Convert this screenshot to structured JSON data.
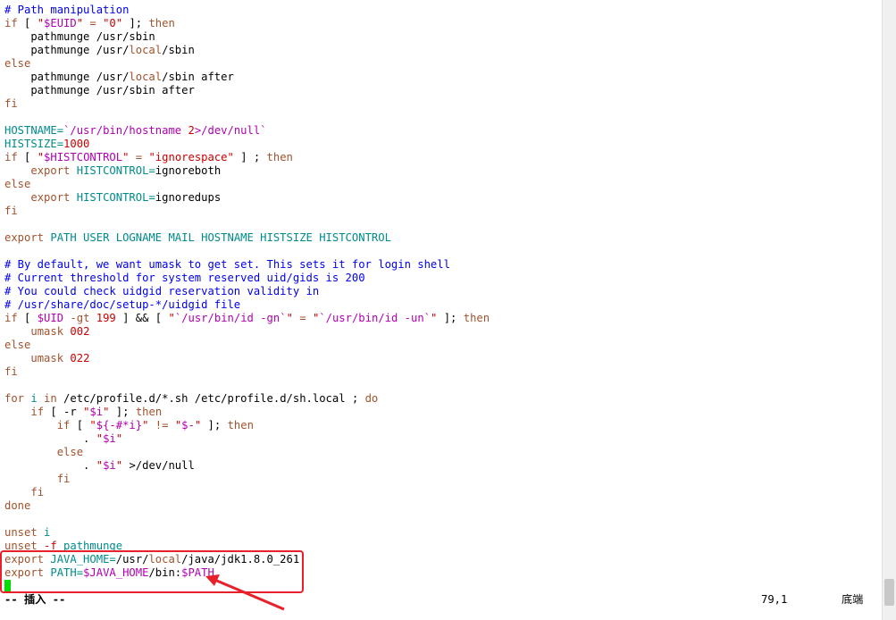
{
  "editor": {
    "lines": [
      [
        {
          "t": "# Path manipulation",
          "c": "cmt"
        }
      ],
      [
        {
          "t": "if",
          "c": "kw"
        },
        {
          "t": " [ ",
          "c": "plain"
        },
        {
          "t": "\"",
          "c": "str"
        },
        {
          "t": "$EUID",
          "c": "var"
        },
        {
          "t": "\"",
          "c": "str"
        },
        {
          "t": " = ",
          "c": "kw"
        },
        {
          "t": "\"0\"",
          "c": "str"
        },
        {
          "t": " ]; ",
          "c": "plain"
        },
        {
          "t": "then",
          "c": "kw"
        }
      ],
      [
        {
          "t": "    pathmunge /usr/sbin",
          "c": "plain"
        }
      ],
      [
        {
          "t": "    pathmunge /usr/",
          "c": "plain"
        },
        {
          "t": "local",
          "c": "kw"
        },
        {
          "t": "/sbin",
          "c": "plain"
        }
      ],
      [
        {
          "t": "else",
          "c": "kw"
        }
      ],
      [
        {
          "t": "    pathmunge /usr/",
          "c": "plain"
        },
        {
          "t": "local",
          "c": "kw"
        },
        {
          "t": "/sbin after",
          "c": "plain"
        }
      ],
      [
        {
          "t": "    pathmunge /usr/sbin after",
          "c": "plain"
        }
      ],
      [
        {
          "t": "fi",
          "c": "kw"
        }
      ],
      [
        {
          "t": "",
          "c": "plain"
        }
      ],
      [
        {
          "t": "HOSTNAME=",
          "c": "id"
        },
        {
          "t": "`/usr/bin/hostname ",
          "c": "var"
        },
        {
          "t": "2",
          "c": "str"
        },
        {
          "t": ">/dev/null`",
          "c": "var"
        }
      ],
      [
        {
          "t": "HISTSIZE=",
          "c": "id"
        },
        {
          "t": "1000",
          "c": "str"
        }
      ],
      [
        {
          "t": "if",
          "c": "kw"
        },
        {
          "t": " [ ",
          "c": "plain"
        },
        {
          "t": "\"",
          "c": "str"
        },
        {
          "t": "$HISTCONTROL",
          "c": "var"
        },
        {
          "t": "\"",
          "c": "str"
        },
        {
          "t": " = ",
          "c": "kw"
        },
        {
          "t": "\"ignorespace\"",
          "c": "str"
        },
        {
          "t": " ] ; ",
          "c": "plain"
        },
        {
          "t": "then",
          "c": "kw"
        }
      ],
      [
        {
          "t": "    ",
          "c": "plain"
        },
        {
          "t": "export",
          "c": "kw"
        },
        {
          "t": " HISTCONTROL=",
          "c": "id"
        },
        {
          "t": "ignoreboth",
          "c": "plain"
        }
      ],
      [
        {
          "t": "else",
          "c": "kw"
        }
      ],
      [
        {
          "t": "    ",
          "c": "plain"
        },
        {
          "t": "export",
          "c": "kw"
        },
        {
          "t": " HISTCONTROL=",
          "c": "id"
        },
        {
          "t": "ignoredups",
          "c": "plain"
        }
      ],
      [
        {
          "t": "fi",
          "c": "kw"
        }
      ],
      [
        {
          "t": "",
          "c": "plain"
        }
      ],
      [
        {
          "t": "export",
          "c": "kw"
        },
        {
          "t": " PATH USER LOGNAME MAIL HOSTNAME HISTSIZE HISTCONTROL",
          "c": "id"
        }
      ],
      [
        {
          "t": "",
          "c": "plain"
        }
      ],
      [
        {
          "t": "# By default, we want umask to get set. This sets it for login shell",
          "c": "cmt"
        }
      ],
      [
        {
          "t": "# Current threshold for system reserved uid/gids is 200",
          "c": "cmt"
        }
      ],
      [
        {
          "t": "# You could check uidgid reservation validity in",
          "c": "cmt"
        }
      ],
      [
        {
          "t": "# /usr/share/doc/setup-*/uidgid file",
          "c": "cmt"
        }
      ],
      [
        {
          "t": "if",
          "c": "kw"
        },
        {
          "t": " [ ",
          "c": "plain"
        },
        {
          "t": "$UID",
          "c": "var"
        },
        {
          "t": " -gt ",
          "c": "kw"
        },
        {
          "t": "199",
          "c": "str"
        },
        {
          "t": " ] ",
          "c": "plain"
        },
        {
          "t": "&&",
          "c": "plain"
        },
        {
          "t": " [ ",
          "c": "plain"
        },
        {
          "t": "\"",
          "c": "str"
        },
        {
          "t": "`/usr/bin/id -gn`",
          "c": "var"
        },
        {
          "t": "\"",
          "c": "str"
        },
        {
          "t": " = ",
          "c": "kw"
        },
        {
          "t": "\"",
          "c": "str"
        },
        {
          "t": "`/usr/bin/id -un`",
          "c": "var"
        },
        {
          "t": "\"",
          "c": "str"
        },
        {
          "t": " ]; ",
          "c": "plain"
        },
        {
          "t": "then",
          "c": "kw"
        }
      ],
      [
        {
          "t": "    ",
          "c": "plain"
        },
        {
          "t": "umask",
          "c": "kw"
        },
        {
          "t": " ",
          "c": "plain"
        },
        {
          "t": "002",
          "c": "str"
        }
      ],
      [
        {
          "t": "else",
          "c": "kw"
        }
      ],
      [
        {
          "t": "    ",
          "c": "plain"
        },
        {
          "t": "umask",
          "c": "kw"
        },
        {
          "t": " ",
          "c": "plain"
        },
        {
          "t": "022",
          "c": "str"
        }
      ],
      [
        {
          "t": "fi",
          "c": "kw"
        }
      ],
      [
        {
          "t": "",
          "c": "plain"
        }
      ],
      [
        {
          "t": "for",
          "c": "kw"
        },
        {
          "t": " i ",
          "c": "id"
        },
        {
          "t": "in",
          "c": "kw"
        },
        {
          "t": " /etc/profile.d/*.sh /etc/profile.d/sh.local ; ",
          "c": "plain"
        },
        {
          "t": "do",
          "c": "kw"
        }
      ],
      [
        {
          "t": "    ",
          "c": "plain"
        },
        {
          "t": "if",
          "c": "kw"
        },
        {
          "t": " [ -r ",
          "c": "plain"
        },
        {
          "t": "\"",
          "c": "str"
        },
        {
          "t": "$i",
          "c": "var"
        },
        {
          "t": "\"",
          "c": "str"
        },
        {
          "t": " ]; ",
          "c": "plain"
        },
        {
          "t": "then",
          "c": "kw"
        }
      ],
      [
        {
          "t": "        ",
          "c": "plain"
        },
        {
          "t": "if",
          "c": "kw"
        },
        {
          "t": " [ ",
          "c": "plain"
        },
        {
          "t": "\"",
          "c": "str"
        },
        {
          "t": "${-#*i}",
          "c": "var"
        },
        {
          "t": "\"",
          "c": "str"
        },
        {
          "t": " != ",
          "c": "kw"
        },
        {
          "t": "\"",
          "c": "str"
        },
        {
          "t": "$-",
          "c": "var"
        },
        {
          "t": "\"",
          "c": "str"
        },
        {
          "t": " ]; ",
          "c": "plain"
        },
        {
          "t": "then",
          "c": "kw"
        }
      ],
      [
        {
          "t": "            . ",
          "c": "plain"
        },
        {
          "t": "\"",
          "c": "str"
        },
        {
          "t": "$i",
          "c": "var"
        },
        {
          "t": "\"",
          "c": "str"
        }
      ],
      [
        {
          "t": "        ",
          "c": "plain"
        },
        {
          "t": "else",
          "c": "kw"
        }
      ],
      [
        {
          "t": "            . ",
          "c": "plain"
        },
        {
          "t": "\"",
          "c": "str"
        },
        {
          "t": "$i",
          "c": "var"
        },
        {
          "t": "\"",
          "c": "str"
        },
        {
          "t": " >/dev/null",
          "c": "plain"
        }
      ],
      [
        {
          "t": "        ",
          "c": "plain"
        },
        {
          "t": "fi",
          "c": "kw"
        }
      ],
      [
        {
          "t": "    ",
          "c": "plain"
        },
        {
          "t": "fi",
          "c": "kw"
        }
      ],
      [
        {
          "t": "done",
          "c": "kw"
        }
      ],
      [
        {
          "t": "",
          "c": "plain"
        }
      ],
      [
        {
          "t": "unset",
          "c": "kw"
        },
        {
          "t": " i",
          "c": "id"
        }
      ],
      [
        {
          "t": "unset",
          "c": "kw"
        },
        {
          "t": " -f ",
          "c": "str"
        },
        {
          "t": "pathmunge",
          "c": "id"
        }
      ],
      [
        {
          "t": "export",
          "c": "kw"
        },
        {
          "t": " JAVA_HOME=",
          "c": "id"
        },
        {
          "t": "/usr/",
          "c": "plain"
        },
        {
          "t": "local",
          "c": "kw"
        },
        {
          "t": "/java/jdk1.8.0_261",
          "c": "plain"
        }
      ],
      [
        {
          "t": "export",
          "c": "kw"
        },
        {
          "t": " PATH=",
          "c": "id"
        },
        {
          "t": "$JAVA_HOME",
          "c": "var"
        },
        {
          "t": "/bin:",
          "c": "plain"
        },
        {
          "t": "$PATH",
          "c": "var"
        }
      ],
      [
        {
          "t": "",
          "c": "plain"
        }
      ]
    ]
  },
  "statusbar": {
    "mode": "-- 插入 --",
    "position": "79,1",
    "scroll": "底端"
  },
  "annotation": {
    "color": "#e8202a"
  }
}
